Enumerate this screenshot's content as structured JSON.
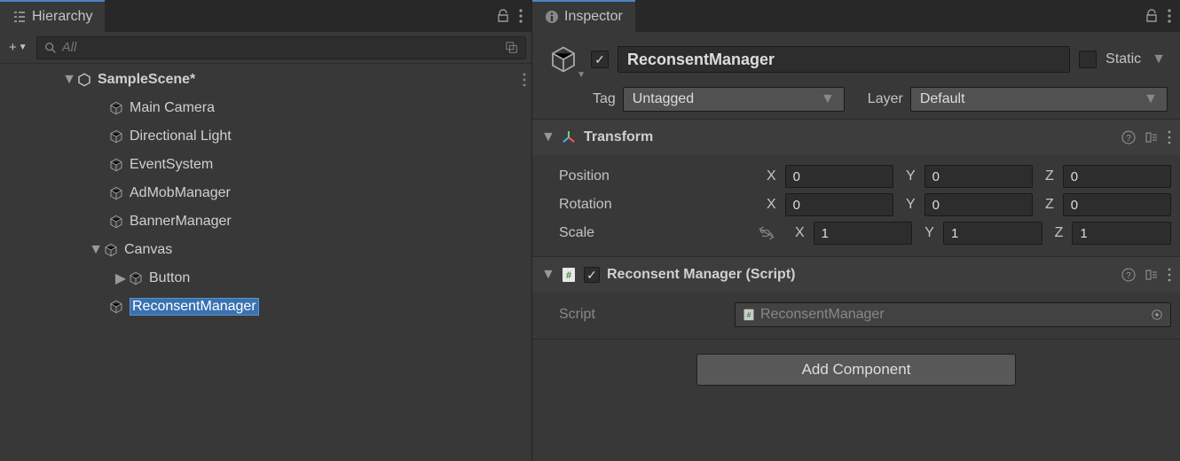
{
  "hierarchy": {
    "tab_label": "Hierarchy",
    "search_placeholder": "All",
    "scene": "SampleScene*",
    "items": [
      {
        "label": "Main Camera",
        "depth": 1,
        "expandable": false
      },
      {
        "label": "Directional Light",
        "depth": 1,
        "expandable": false
      },
      {
        "label": "EventSystem",
        "depth": 1,
        "expandable": false
      },
      {
        "label": "AdMobManager",
        "depth": 1,
        "expandable": false
      },
      {
        "label": "BannerManager",
        "depth": 1,
        "expandable": false
      },
      {
        "label": "Canvas",
        "depth": 1,
        "expandable": true,
        "expanded": true
      },
      {
        "label": "Button",
        "depth": 2,
        "expandable": true,
        "expanded": false
      },
      {
        "label": "ReconsentManager",
        "depth": 1,
        "expandable": false,
        "selected_edit": true
      }
    ]
  },
  "inspector": {
    "tab_label": "Inspector",
    "object": {
      "active": true,
      "name": "ReconsentManager",
      "static_label": "Static",
      "static_checked": false,
      "tag_label": "Tag",
      "tag_value": "Untagged",
      "layer_label": "Layer",
      "layer_value": "Default"
    },
    "transform": {
      "title": "Transform",
      "position_label": "Position",
      "rotation_label": "Rotation",
      "scale_label": "Scale",
      "position": {
        "x": "0",
        "y": "0",
        "z": "0"
      },
      "rotation": {
        "x": "0",
        "y": "0",
        "z": "0"
      },
      "scale": {
        "x": "1",
        "y": "1",
        "z": "1"
      }
    },
    "script_component": {
      "title": "Reconsent Manager (Script)",
      "enabled": true,
      "script_label": "Script",
      "script_value": "ReconsentManager"
    },
    "add_component_label": "Add Component"
  }
}
